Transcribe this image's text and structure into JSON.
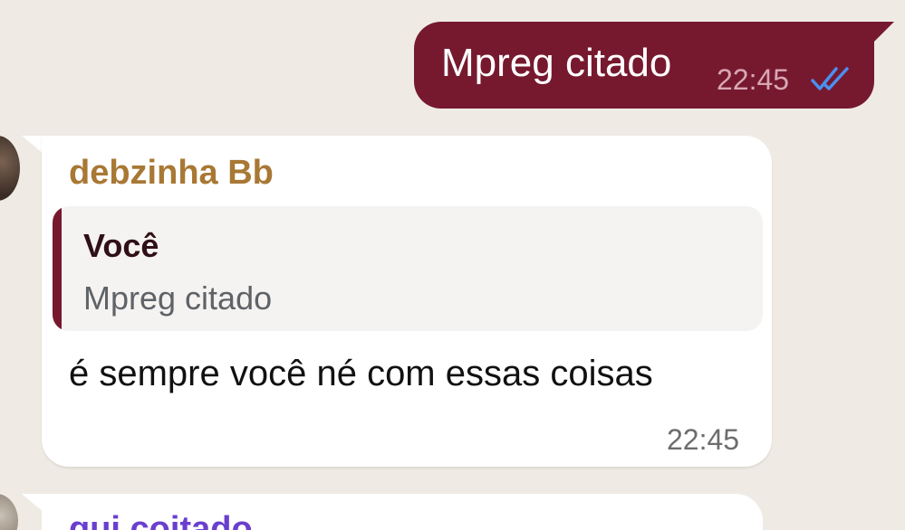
{
  "messages": {
    "outgoing": {
      "text": "Mpreg citado",
      "time": "22:45",
      "status_icon": "double-check-icon",
      "bubble_color": "#76192f"
    },
    "incoming": {
      "sender": "debzinha Bb",
      "sender_color": "#a87834",
      "quote": {
        "author": "Você",
        "text": "Mpreg citado"
      },
      "text": "é sempre você né com essas coisas",
      "time": "22:45"
    },
    "next_incoming": {
      "sender": "gui coitado",
      "sender_color": "#6a3fcf"
    }
  }
}
